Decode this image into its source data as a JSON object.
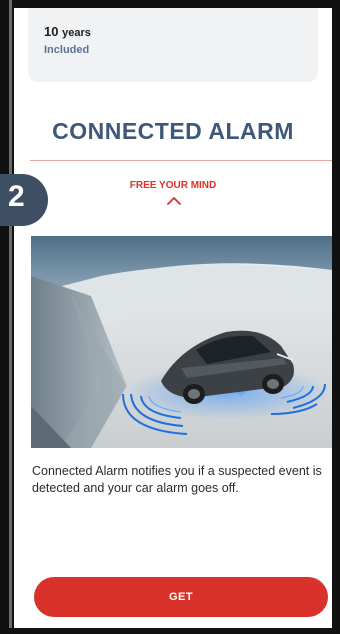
{
  "plan_card": {
    "duration_value": "10",
    "duration_unit": "years",
    "status": "Included"
  },
  "section": {
    "title": "CONNECTED ALARM",
    "tagline": "FREE YOUR MIND",
    "step_number": "2",
    "description": "Connected Alarm notifies you if a suspected event is detected and your car alarm goes off."
  },
  "actions": {
    "get_label": "GET"
  },
  "icons": {
    "collapse": "chevron-up-icon"
  },
  "colors": {
    "accent_red": "#d8322a",
    "title_blue": "#3f5878",
    "badge": "#3e4f63",
    "card_bg": "#f1f2f4",
    "alarm_ring": "#1f6fe0"
  }
}
